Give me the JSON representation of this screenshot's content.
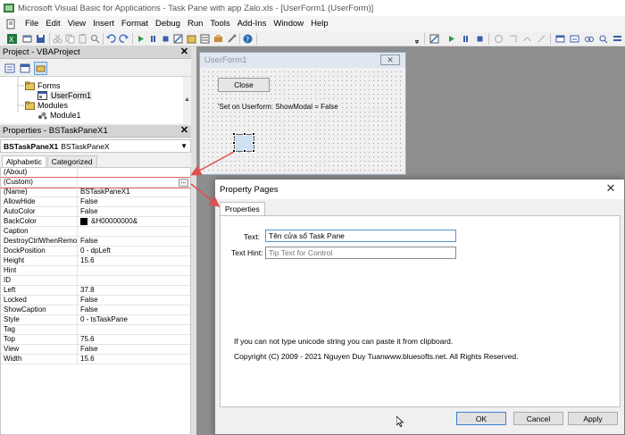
{
  "window": {
    "title": "Microsoft Visual Basic for Applications - Task Pane with app Zalo.xls - [UserForm1 (UserForm)]"
  },
  "menu": {
    "items": [
      "File",
      "Edit",
      "View",
      "Insert",
      "Format",
      "Debug",
      "Run",
      "Tools",
      "Add-Ins",
      "Window",
      "Help"
    ]
  },
  "project_pane": {
    "title": "Project - VBAProject",
    "tree": [
      {
        "label": "Forms",
        "icon": "folder-icon"
      },
      {
        "label": "UserForm1",
        "icon": "userform-icon"
      },
      {
        "label": "Modules",
        "icon": "folder-icon"
      },
      {
        "label": "Module1",
        "icon": "module-icon"
      }
    ]
  },
  "properties_pane": {
    "title": "Properties - BSTaskPaneX1",
    "object_name": "BSTaskPaneX1",
    "object_type": "BSTaskPaneX",
    "tabs": [
      "Alphabetic",
      "Categorized"
    ],
    "rows": [
      {
        "name": "(About)",
        "value": ""
      },
      {
        "name": "(Custom)",
        "value": ""
      },
      {
        "name": "(Name)",
        "value": "BSTaskPaneX1"
      },
      {
        "name": "AllowHide",
        "value": "False"
      },
      {
        "name": "AutoColor",
        "value": "False"
      },
      {
        "name": "BackColor",
        "value": "&H00000000&"
      },
      {
        "name": "Caption",
        "value": ""
      },
      {
        "name": "DestroyCtrlWhenRemove",
        "value": "False"
      },
      {
        "name": "DockPosition",
        "value": "0 - dpLeft"
      },
      {
        "name": "Height",
        "value": "15.6"
      },
      {
        "name": "Hint",
        "value": ""
      },
      {
        "name": "ID",
        "value": ""
      },
      {
        "name": "Left",
        "value": "37.8"
      },
      {
        "name": "Locked",
        "value": "False"
      },
      {
        "name": "ShowCaption",
        "value": "False"
      },
      {
        "name": "Style",
        "value": "0 - tsTaskPane"
      },
      {
        "name": "Tag",
        "value": ""
      },
      {
        "name": "Top",
        "value": "75.6"
      },
      {
        "name": "View",
        "value": "False"
      },
      {
        "name": "Width",
        "value": "15.6"
      }
    ],
    "ellipsis_label": "..."
  },
  "userform": {
    "title": "UserForm1",
    "close_button_label": "Close",
    "label_text": "'Set on Userform: ShowModal = False"
  },
  "dialog": {
    "title": "Property Pages",
    "tab": "Properties",
    "text_label": "Text:",
    "text_value": "Tên cửa sổ Task Pane",
    "hint_label": "Text Hint:",
    "hint_placeholder": "Tip Text for Control",
    "note_line": "If  you can not type unicode string you can paste it from clipboard.",
    "copyright_line": "Copyright (C) 2009 - 2021 Nguyen Duy Tuanwww.bluesofts.net. All Rights Reserved.",
    "buttons": {
      "ok": "OK",
      "cancel": "Cancel",
      "apply": "Apply"
    }
  },
  "colors": {
    "arrow": "#e05050",
    "selected_row": "#e06060",
    "backcolor_swatch": "#000000"
  }
}
